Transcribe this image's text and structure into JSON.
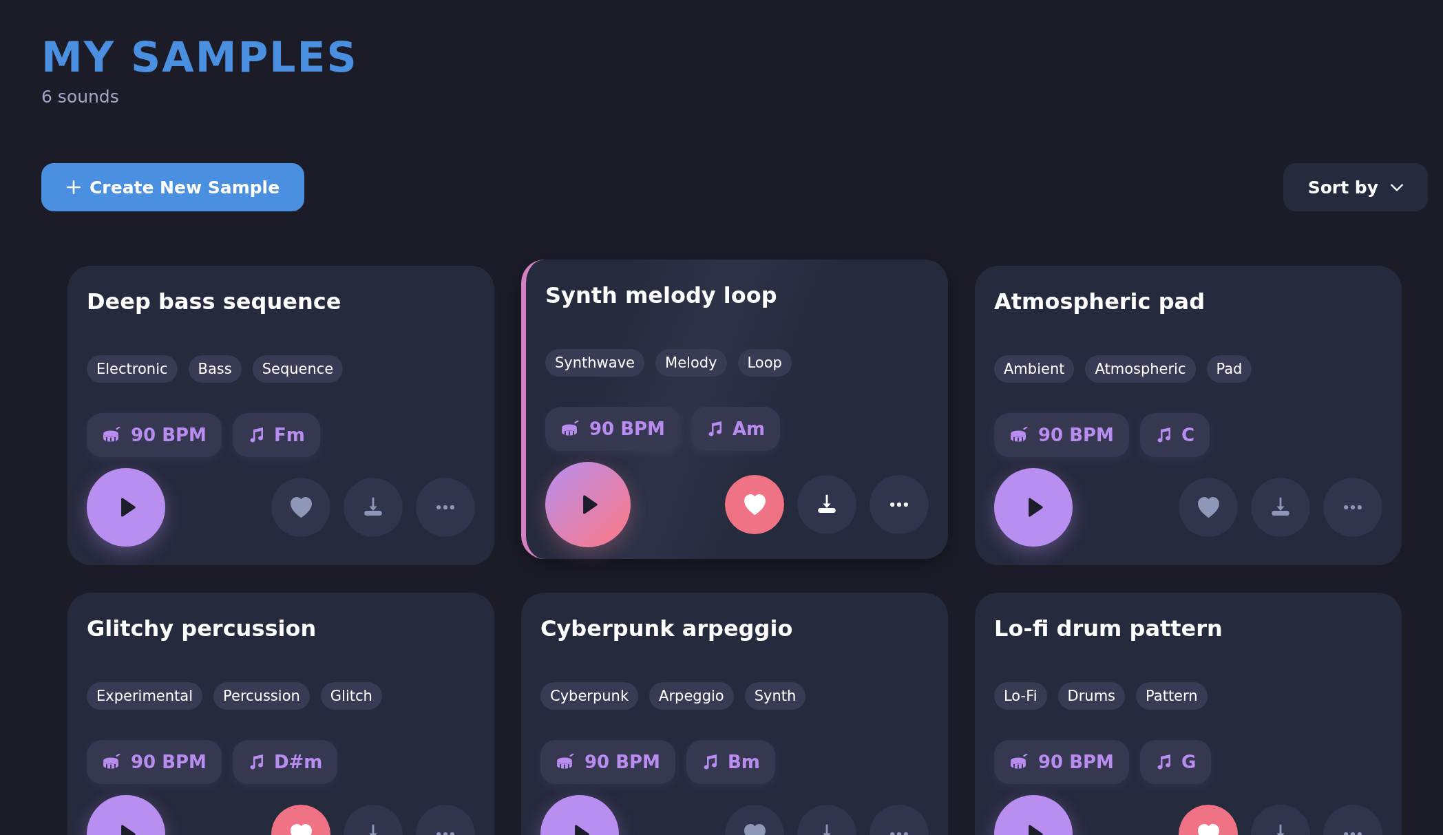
{
  "header": {
    "title": "MY SAMPLES",
    "count": "6 sounds"
  },
  "toolbar": {
    "create_button": "Create New Sample",
    "sort_button": "Sort by"
  },
  "samples": [
    {
      "title": "Deep bass sequence",
      "tags": [
        "Electronic",
        "Bass",
        "Sequence"
      ],
      "bpm": "90 BPM",
      "key": "Fm",
      "favorite": false,
      "active": false
    },
    {
      "title": "Synth melody loop",
      "tags": [
        "Synthwave",
        "Melody",
        "Loop"
      ],
      "bpm": "90 BPM",
      "key": "Am",
      "favorite": true,
      "active": true
    },
    {
      "title": "Atmospheric pad",
      "tags": [
        "Ambient",
        "Atmospheric",
        "Pad"
      ],
      "bpm": "90 BPM",
      "key": "C",
      "favorite": false,
      "active": false
    },
    {
      "title": "Glitchy percussion",
      "tags": [
        "Experimental",
        "Percussion",
        "Glitch"
      ],
      "bpm": "90 BPM",
      "key": "D#m",
      "favorite": true,
      "active": false
    },
    {
      "title": "Cyberpunk arpeggio",
      "tags": [
        "Cyberpunk",
        "Arpeggio",
        "Synth"
      ],
      "bpm": "90 BPM",
      "key": "Bm",
      "favorite": false,
      "active": false
    },
    {
      "title": "Lo-fi drum pattern",
      "tags": [
        "Lo-Fi",
        "Drums",
        "Pattern"
      ],
      "bpm": "90 BPM",
      "key": "G",
      "favorite": true,
      "active": false
    }
  ]
}
